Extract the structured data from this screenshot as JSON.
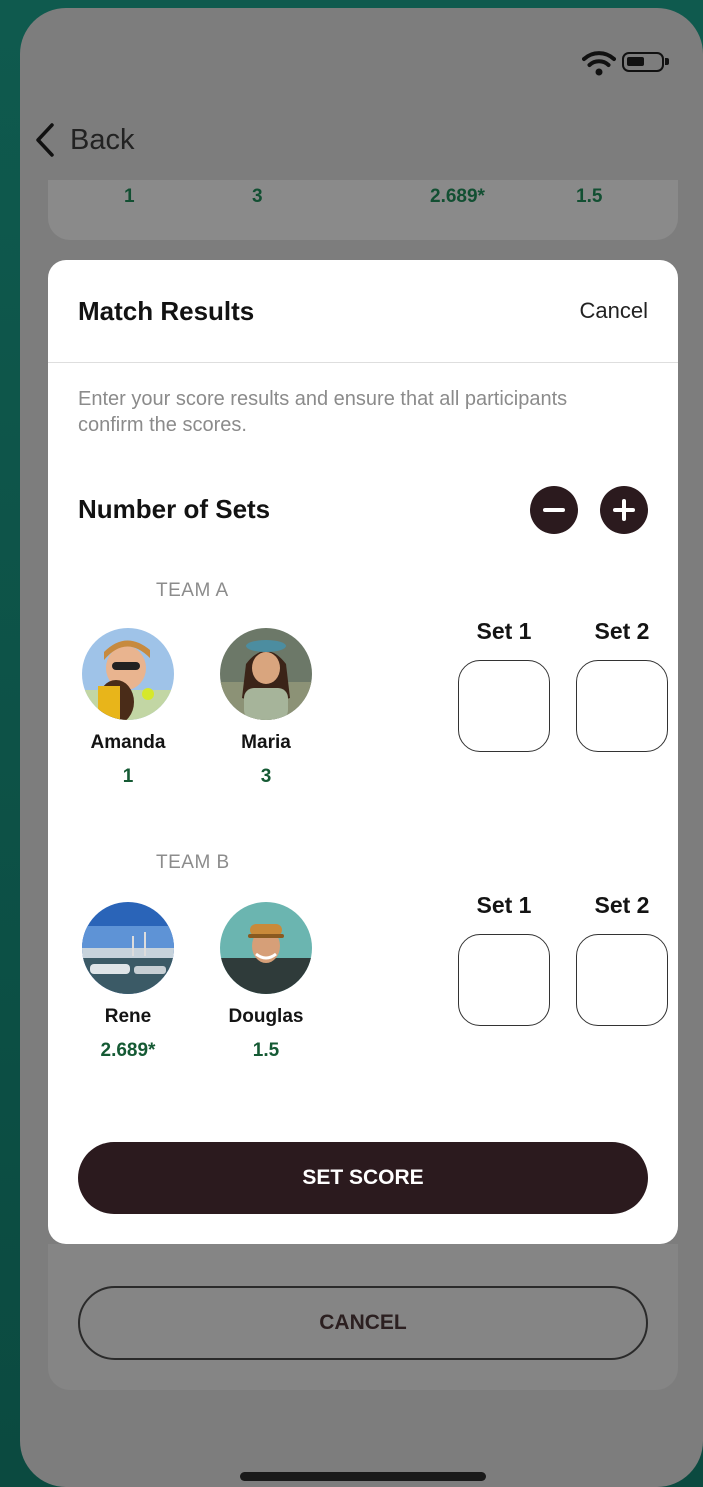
{
  "nav": {
    "back_label": "Back"
  },
  "background": {
    "ratings": [
      "1",
      "3",
      "2.689*",
      "1.5"
    ],
    "cancel_label": "CANCEL"
  },
  "modal": {
    "title": "Match Results",
    "cancel_label": "Cancel",
    "description": "Enter your score results and ensure that all participants confirm the scores.",
    "sets_label": "Number of Sets",
    "set_score_label": "SET SCORE",
    "teams": [
      {
        "label": "TEAM A",
        "players": [
          {
            "name": "Amanda",
            "rating": "1"
          },
          {
            "name": "Maria",
            "rating": "3"
          }
        ],
        "sets": [
          "Set 1",
          "Set 2"
        ]
      },
      {
        "label": "TEAM B",
        "players": [
          {
            "name": "Rene",
            "rating": "2.689*"
          },
          {
            "name": "Douglas",
            "rating": "1.5"
          }
        ],
        "sets": [
          "Set 1",
          "Set 2"
        ]
      }
    ]
  },
  "colors": {
    "primary_dark": "#2b1a1e",
    "rating_green": "#155a34",
    "app_background": "#0f5a4e"
  }
}
